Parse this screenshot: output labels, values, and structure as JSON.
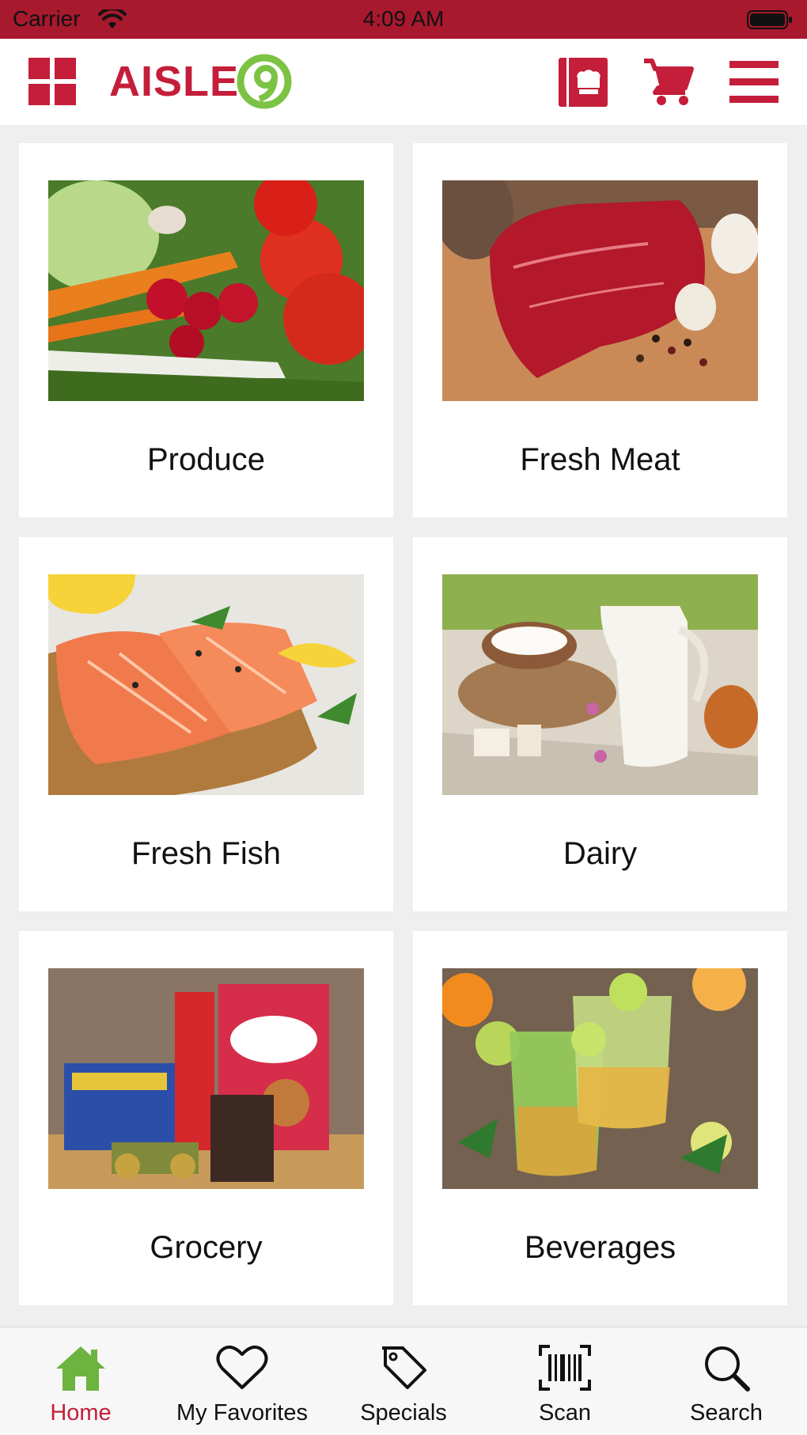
{
  "status_bar": {
    "carrier": "Carrier",
    "time": "4:09 AM"
  },
  "header": {
    "logo_text": "AISLE",
    "logo_mark": "9",
    "brand_color": "#c41e3a",
    "logo_accent_color": "#7cc243",
    "icons": [
      "grid-icon",
      "recipe-book-icon",
      "cart-icon",
      "menu-icon"
    ]
  },
  "categories": [
    {
      "label": "Produce",
      "image": "produce-image"
    },
    {
      "label": "Fresh Meat",
      "image": "fresh-meat-image"
    },
    {
      "label": "Fresh Fish",
      "image": "fresh-fish-image"
    },
    {
      "label": "Dairy",
      "image": "dairy-image"
    },
    {
      "label": "Grocery",
      "image": "grocery-image"
    },
    {
      "label": "Beverages",
      "image": "beverages-image"
    }
  ],
  "tab_bar": {
    "active_tab": "Home",
    "active_color": "#6cb33f",
    "tabs": [
      {
        "label": "Home",
        "icon": "home-icon"
      },
      {
        "label": "My Favorites",
        "icon": "heart-icon"
      },
      {
        "label": "Specials",
        "icon": "tag-icon"
      },
      {
        "label": "Scan",
        "icon": "barcode-icon"
      },
      {
        "label": "Search",
        "icon": "search-icon"
      }
    ]
  }
}
